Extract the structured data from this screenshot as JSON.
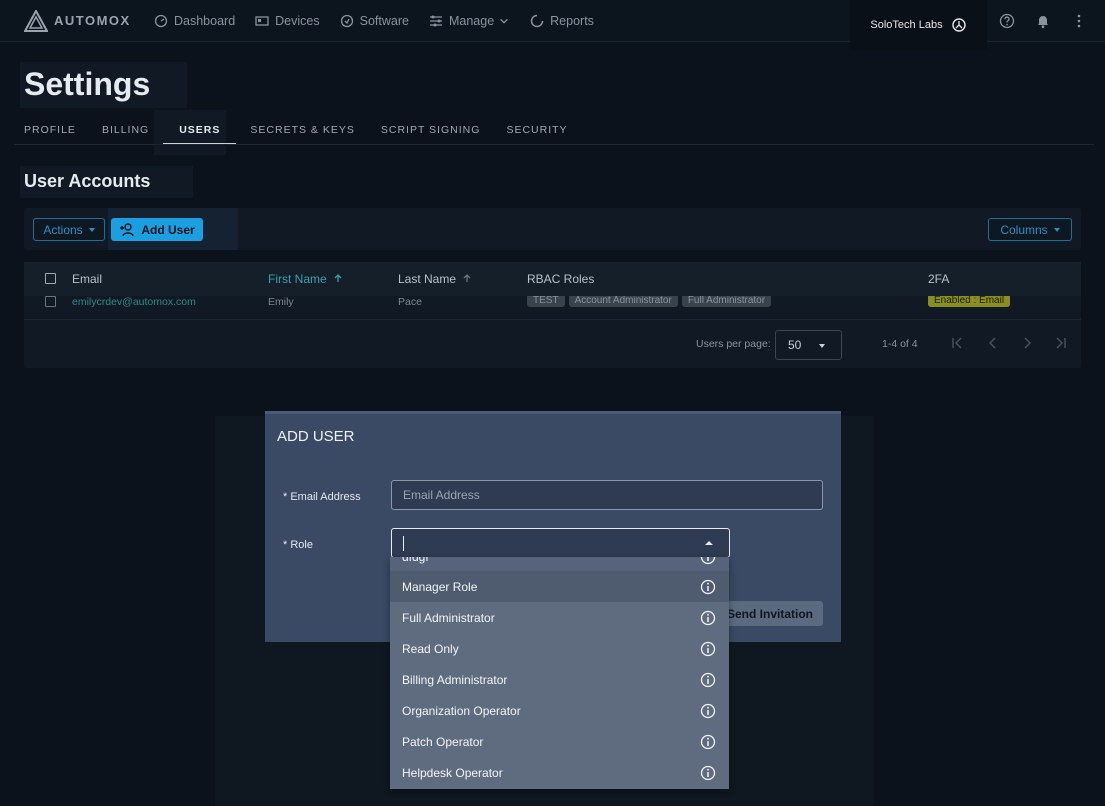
{
  "brand": {
    "name": "AUTOMOX"
  },
  "nav": {
    "items": [
      {
        "label": "Dashboard",
        "icon": "dashboard-icon"
      },
      {
        "label": "Devices",
        "icon": "devices-icon"
      },
      {
        "label": "Software",
        "icon": "software-icon"
      },
      {
        "label": "Manage",
        "icon": "manage-icon"
      },
      {
        "label": "Reports",
        "icon": "reports-icon"
      }
    ],
    "org_name": "SoloTech Labs"
  },
  "page": {
    "title": "Settings"
  },
  "tabs": [
    "PROFILE",
    "BILLING",
    "USERS",
    "SECRETS & KEYS",
    "SCRIPT SIGNING",
    "SECURITY"
  ],
  "section": {
    "title": "User Accounts"
  },
  "toolbar": {
    "actions_label": "Actions",
    "add_user_label": "Add User",
    "columns_label": "Columns"
  },
  "table": {
    "headers": {
      "email": "Email",
      "first_name": "First Name",
      "last_name": "Last Name",
      "rbac": "RBAC Roles",
      "twofa": "2FA"
    },
    "row": {
      "email": "emilycrdev@automox.com",
      "first_name": "Emily",
      "last_name": "Pace",
      "roles": [
        "TEST",
        "Account Administrator",
        "Full Administrator"
      ],
      "twofa": "Enabled : Email"
    },
    "pager": {
      "per_page_label": "Users per page:",
      "per_page_value": "50",
      "range": "1-4 of 4"
    }
  },
  "modal": {
    "title": "ADD USER",
    "email_label": "* Email Address",
    "email_placeholder": "Email Address",
    "role_label": "* Role",
    "send_label": "Send Invitation"
  },
  "role_options": [
    "dfdgf",
    "Manager Role",
    "Full Administrator",
    "Read Only",
    "Billing Administrator",
    "Organization Operator",
    "Patch Operator",
    "Helpdesk Operator"
  ],
  "colors": {
    "accent": "#1a9fe0",
    "modal_bg": "#3a4964",
    "dropdown_bg": "#5f6c7f"
  }
}
